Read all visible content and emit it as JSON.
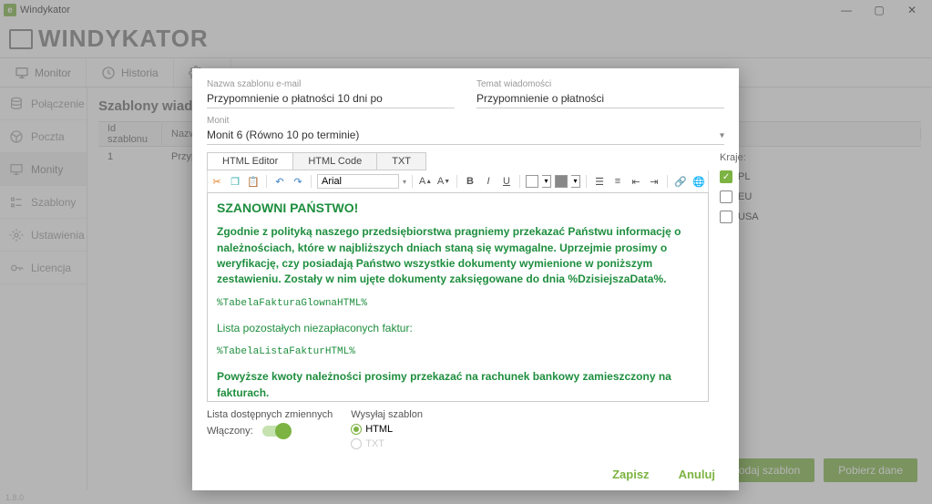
{
  "window": {
    "title": "Windykator",
    "app_name": "WINDYKATOR",
    "version": "1.8.0"
  },
  "main_tabs": {
    "monitor": "Monitor",
    "history": "Historia",
    "settings_partial": "U"
  },
  "sidebar": {
    "items": [
      {
        "label": "Połączenie"
      },
      {
        "label": "Poczta"
      },
      {
        "label": "Monity"
      },
      {
        "label": "Szablony"
      },
      {
        "label": "Ustawienia"
      },
      {
        "label": "Licencja"
      }
    ]
  },
  "content": {
    "heading_partial": "Szablony wiadom",
    "columns": {
      "id": "Id szablonu",
      "name": "Nazw"
    },
    "row": {
      "id": "1",
      "name": "Przypom"
    }
  },
  "buttons": {
    "add_template": "Dodaj szablon",
    "download_data": "Pobierz dane"
  },
  "modal": {
    "labels": {
      "tpl_name": "Nazwa szablonu e-mail",
      "subject": "Temat wiadomości",
      "monit": "Monit",
      "countries": "Kraje:",
      "vars_link": "Lista dostępnych zmiennych",
      "send_as": "Wysyłaj szablon",
      "enabled": "Włączony:"
    },
    "values": {
      "tpl_name": "Przypomnienie o płatności 10 dni po",
      "subject": "Przypomnienie o płatności",
      "monit_selected": "Monit 6 (Równo 10 po terminie)",
      "font": "Arial"
    },
    "editor_tabs": {
      "html_editor": "HTML Editor",
      "html_code": "HTML Code",
      "txt": "TXT"
    },
    "countries": {
      "pl": "PL",
      "eu": "EU",
      "usa": "USA"
    },
    "radios": {
      "html": "HTML",
      "txt": "TXT"
    },
    "actions": {
      "save": "Zapisz",
      "cancel": "Anuluj"
    },
    "editor": {
      "heading": "SZANOWNI PAŃSTWO!",
      "body1": "Zgodnie z polityką naszego przedsiębiorstwa pragniemy przekazać Państwu informację o należnościach, które w najbliższych dniach staną się wymagalne. Uprzejmie prosimy o weryfikację, czy posiadają Państwo wszystkie dokumenty wymienione w poniższym zestawieniu. Zostały w nim ujęte dokumenty zaksięgowane do dnia %DzisiejszaData%.",
      "token1": "%TabelaFakturaGlownaHTML%",
      "body2": "Lista pozostałych niezapłaconych faktur:",
      "token2": "%TabelaListaFakturHTML%",
      "body3": "Powyższe kwoty należności prosimy przekazać na rachunek bankowy zamieszczony na fakturach."
    }
  }
}
